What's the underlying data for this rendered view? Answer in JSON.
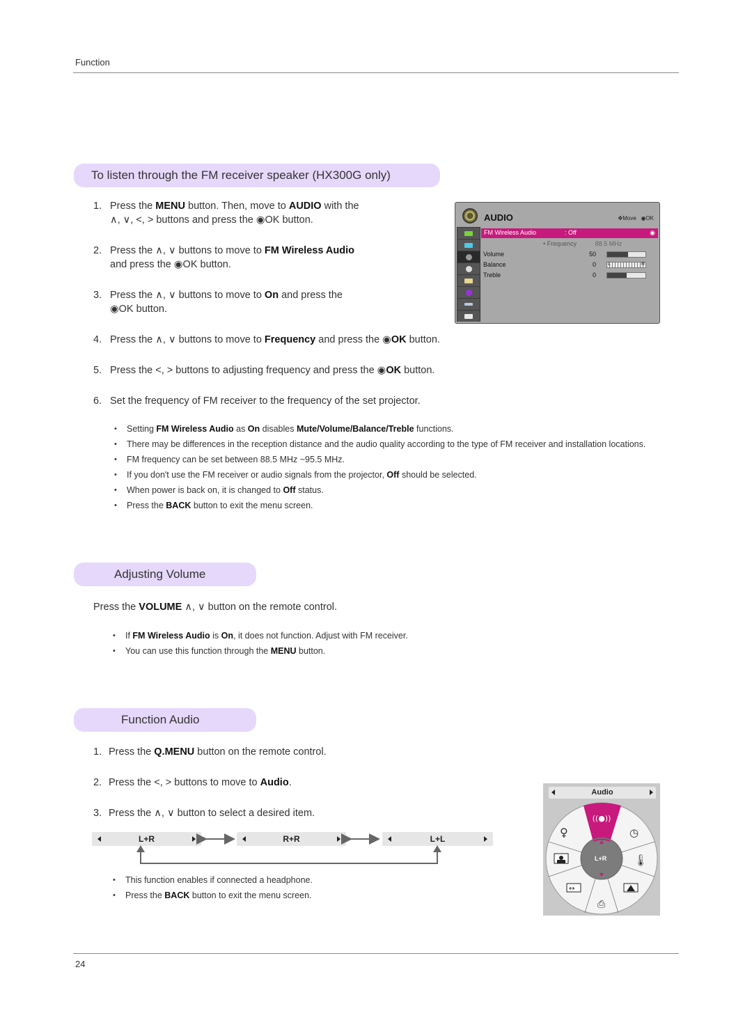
{
  "header": {
    "running_head": "Function"
  },
  "footer": {
    "page_number": "24"
  },
  "sections": {
    "fm": {
      "title": "To listen through the FM receiver speaker (HX300G only)",
      "steps": [
        {
          "num": "1.",
          "line1_parts": [
            "Press the ",
            "MENU",
            " button. Then, move to ",
            "AUDIO",
            " with the"
          ],
          "line2": "∧, ∨, <, >  buttons and press the ◉OK button."
        },
        {
          "num": "2.",
          "line1_parts": [
            "Press the ∧, ∨ buttons to move to ",
            "FM Wireless Audio"
          ],
          "line2": "and press the ◉OK button."
        },
        {
          "num": "3.",
          "line1_parts": [
            "Press the ∧, ∨ buttons to move to ",
            "On",
            " and press the"
          ],
          "line2": "◉OK button."
        },
        {
          "num": "4.",
          "line1_parts": [
            "Press the ∧, ∨ buttons to move to ",
            "Frequency",
            " and press the ◉",
            "OK",
            " button."
          ]
        },
        {
          "num": "5.",
          "line1_parts": [
            "Press the <, > buttons to adjusting frequency and press the ◉",
            "OK",
            " button."
          ]
        },
        {
          "num": "6.",
          "line1_parts": [
            "Set the frequency of FM receiver to the frequency of the set projector."
          ]
        }
      ],
      "notes": [
        [
          "Setting ",
          "FM Wireless Audio",
          " as ",
          "On",
          " disables ",
          "Mute/Volume/Balance/Treble",
          " functions."
        ],
        [
          "There may be differences in the reception distance and the audio quality according to the type of FM receiver and installation locations."
        ],
        [
          "FM frequency can be set between 88.5 MHz ~95.5 MHz."
        ],
        [
          "If you don't use the FM receiver or audio signals from the projector, ",
          "Off",
          " should be selected."
        ],
        [
          "When power is back on, it is changed to ",
          "Off",
          " status."
        ],
        [
          "Press the ",
          "BACK",
          " button to exit the menu screen."
        ]
      ]
    },
    "volume": {
      "title": "Adjusting Volume",
      "instruction_parts": [
        "Press the ",
        "VOLUME",
        " ∧, ∨ button on the remote control."
      ],
      "notes": [
        [
          "If ",
          "FM Wireless Audio",
          " is ",
          "On",
          ", it does not function. Adjust with FM receiver."
        ],
        [
          "You can use this function through the ",
          "MENU",
          " button."
        ]
      ]
    },
    "function_audio": {
      "title": "Function Audio",
      "steps": [
        {
          "num": "1.",
          "parts": [
            "Press the ",
            "Q.MENU",
            " button on the remote control."
          ]
        },
        {
          "num": "2.",
          "parts": [
            "Press the <, > buttons to move to ",
            "Audio",
            "."
          ]
        },
        {
          "num": "3.",
          "parts": [
            "Press the ∧, ∨ button to select a desired item."
          ]
        }
      ],
      "modes": [
        "L+R",
        "R+R",
        "L+L"
      ],
      "notes": [
        [
          "This function enables if connected a headphone."
        ],
        [
          "Press the ",
          "BACK",
          " button to exit the menu screen."
        ]
      ]
    }
  },
  "osd_menu": {
    "title": "AUDIO",
    "hint_move": "Move",
    "hint_ok": "◉OK",
    "selected_item": {
      "label": "FM Wireless Audio",
      "value": ": Off"
    },
    "frequency": {
      "label": "• Frequency",
      "value": "88.5 MHz"
    },
    "rows": [
      {
        "label": "Volume",
        "value": "50",
        "fill": 0.55
      },
      {
        "label": "Balance",
        "value": "0",
        "type": "balance"
      },
      {
        "label": "Treble",
        "value": "0",
        "fill": 0.5
      }
    ],
    "accent_color": "#c8197d"
  },
  "qmenu": {
    "title": "Audio",
    "center_label": "L+R",
    "accent_color": "#c8197d"
  }
}
